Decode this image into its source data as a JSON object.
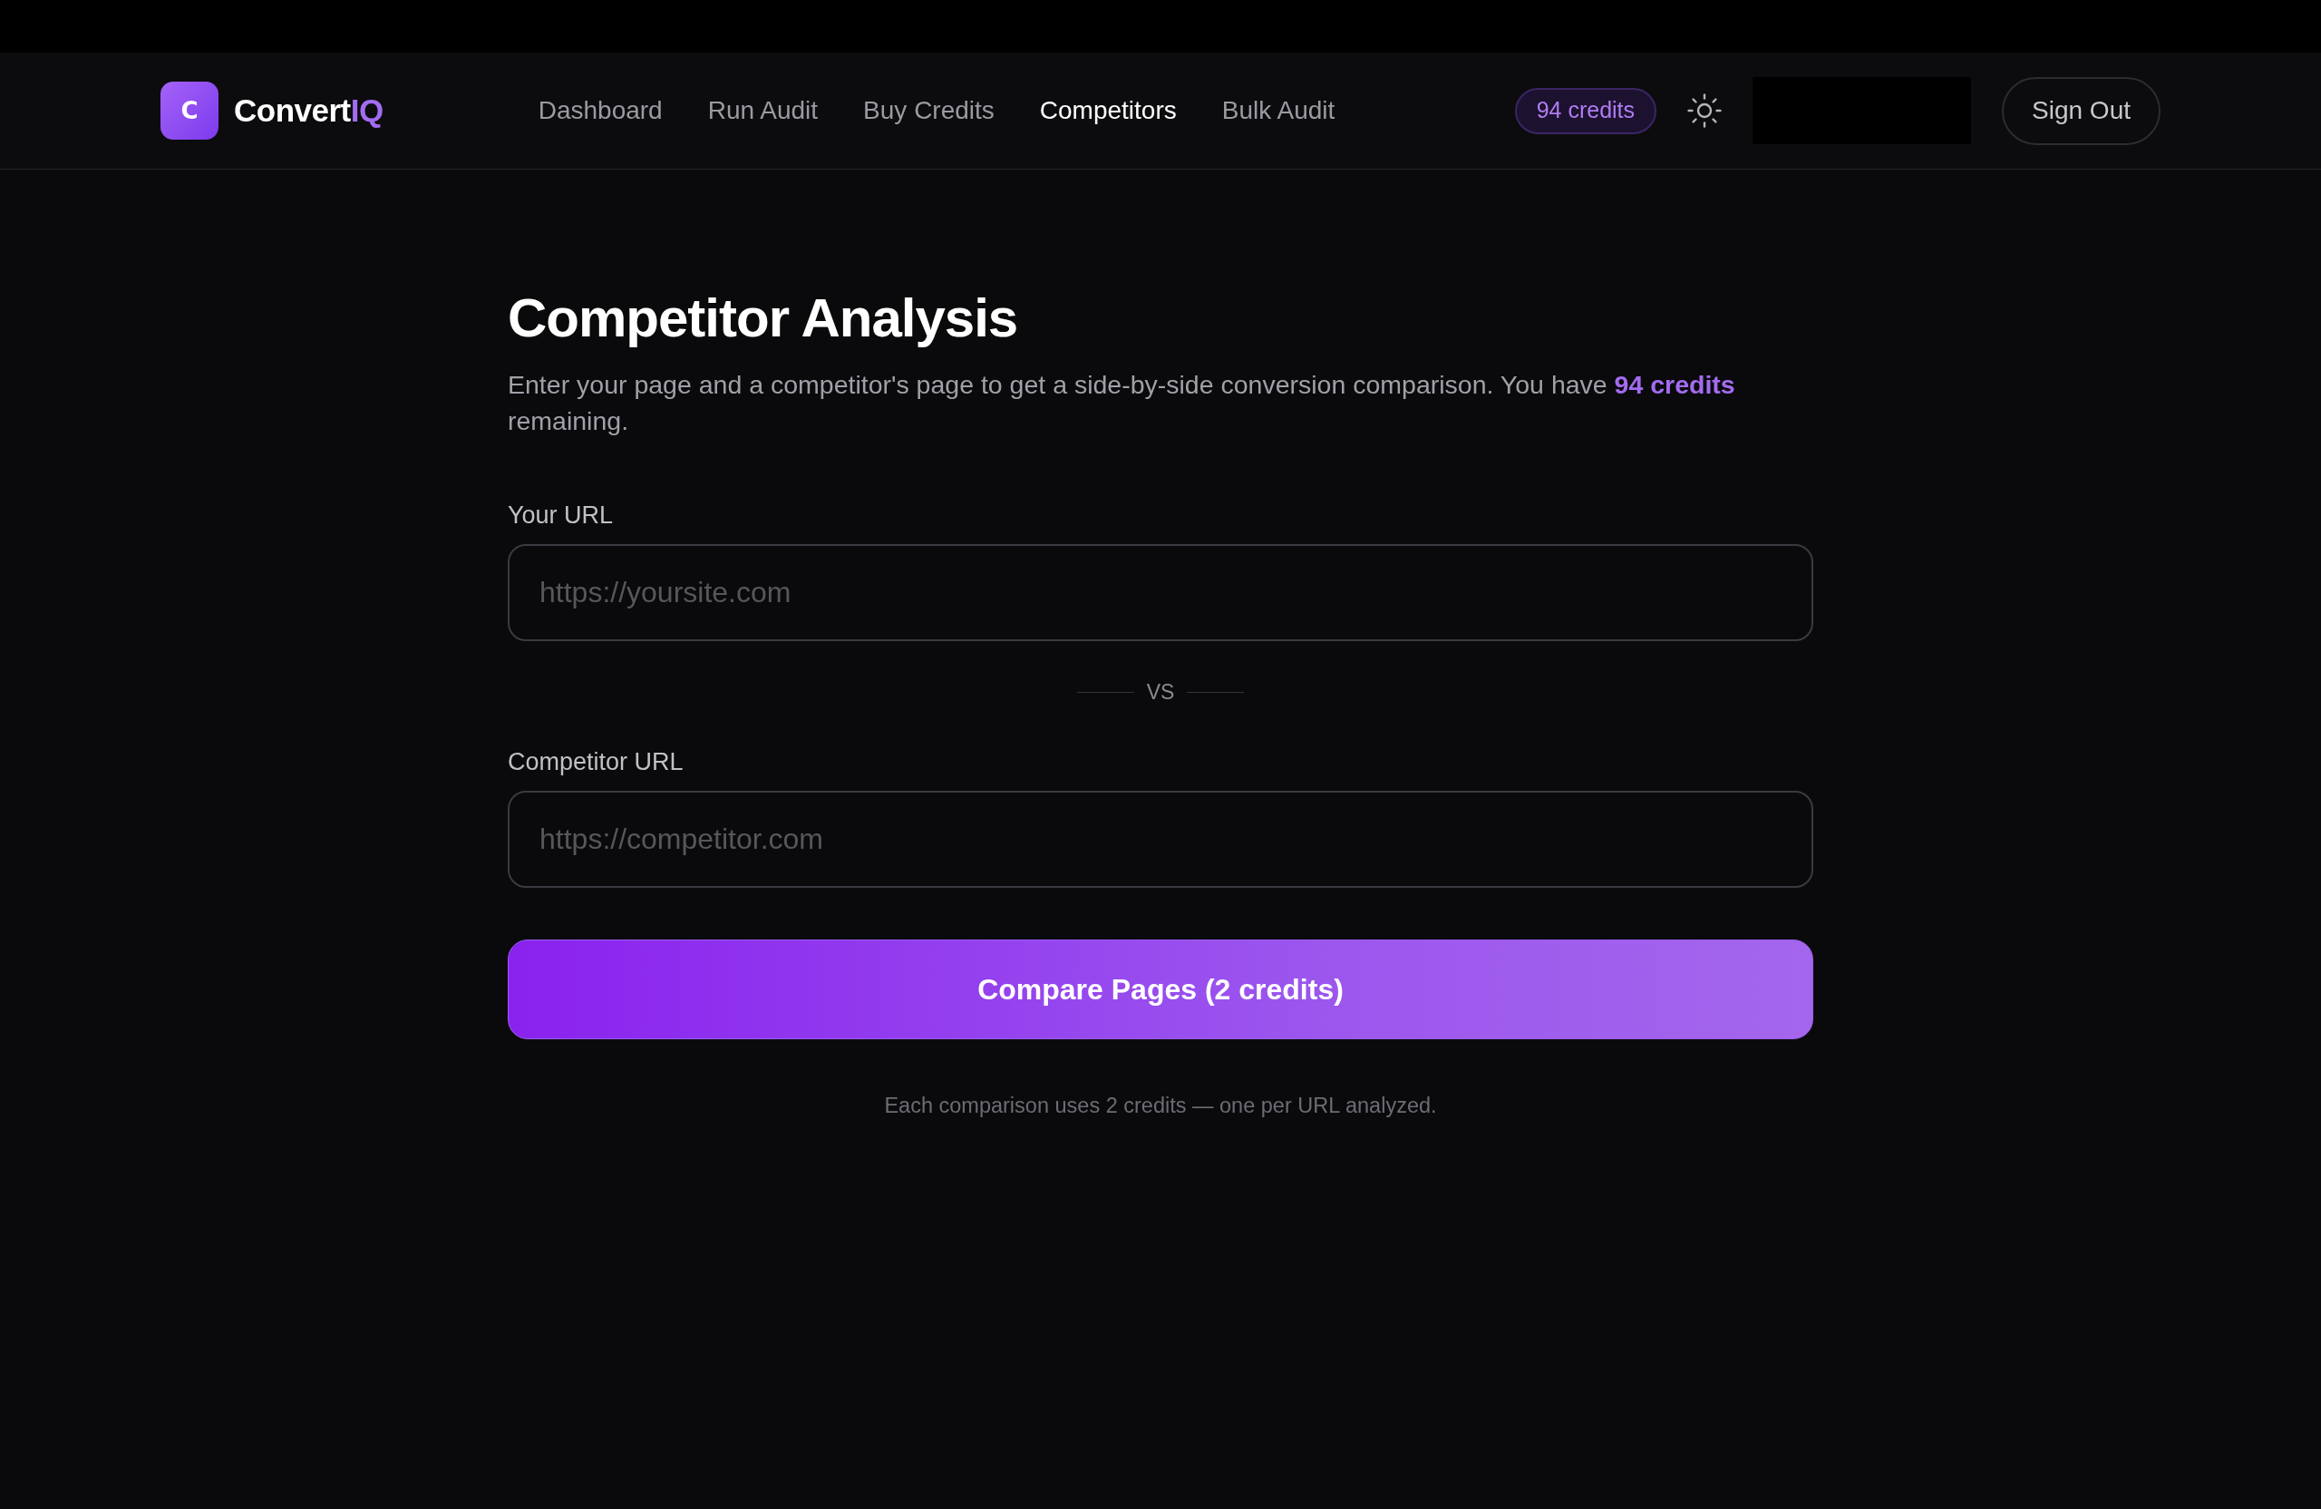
{
  "brand": {
    "icon_letter": "C",
    "name": "Convert",
    "name_accent": "IQ"
  },
  "nav": [
    {
      "label": "Dashboard",
      "selected": false
    },
    {
      "label": "Run Audit",
      "selected": false
    },
    {
      "label": "Buy Credits",
      "selected": false
    },
    {
      "label": "Competitors",
      "selected": true
    },
    {
      "label": "Bulk Audit",
      "selected": false
    }
  ],
  "credits_badge": "94 credits",
  "sign_out": "Sign Out",
  "page": {
    "title": "Competitor Analysis",
    "intro": "Enter your page and a competitor's page to get a side-by-side conversion comparison. You have **94 credits** remaining."
  },
  "fields": [
    {
      "label": "Your URL",
      "placeholder": "https://yoursite.com"
    },
    {
      "label": "Competitor URL",
      "placeholder": "https://competitor.com"
    }
  ],
  "divider_label": "VS",
  "submit_button": "Compare Pages (2 credits)",
  "note": "Each comparison uses 2 credits — one per URL analyzed."
}
